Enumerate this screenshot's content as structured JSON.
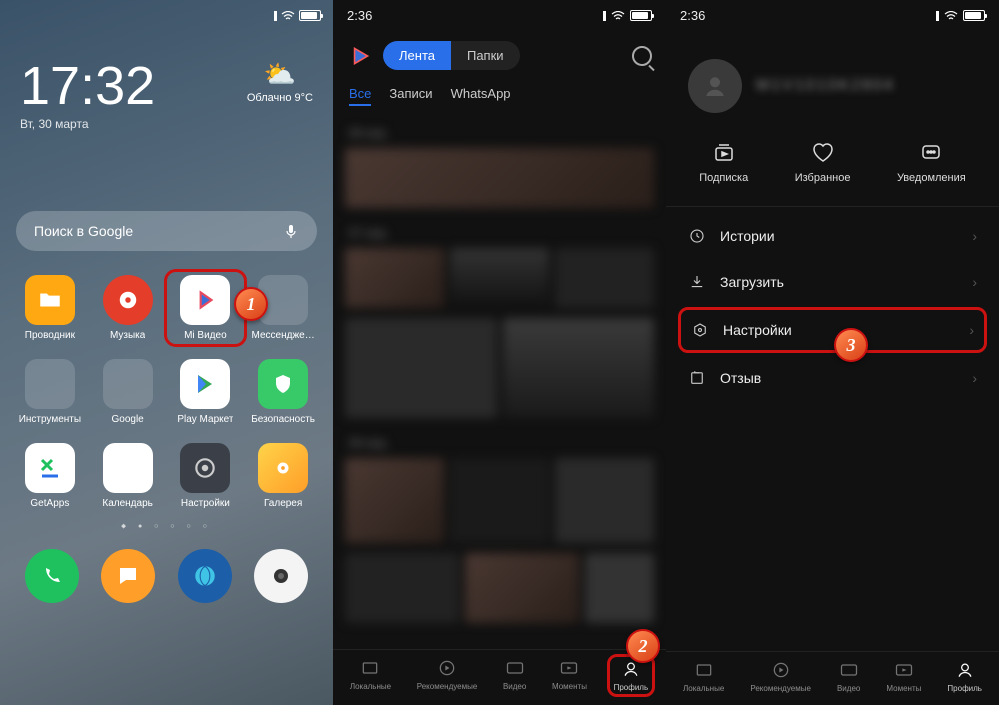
{
  "phone1": {
    "time": "17:32",
    "date": "Вт, 30 марта",
    "weather": {
      "cond": "Облачно",
      "temp": "9°C"
    },
    "search": "Поиск в Google",
    "apps": [
      {
        "label": "Проводник",
        "bg": "#ffa812"
      },
      {
        "label": "Музыка",
        "bg": "#e43d2a"
      },
      {
        "label": "Mi Видео",
        "bg": "#ffffff",
        "hl": true
      },
      {
        "label": "Мессендже…",
        "bg": "#2a2a33",
        "folder": true
      },
      {
        "label": "Инструменты",
        "bg": "#2a2a33",
        "folder": true
      },
      {
        "label": "Google",
        "bg": "#2a2a33",
        "folder": true
      },
      {
        "label": "Play Маркет",
        "bg": "#ffffff"
      },
      {
        "label": "Безопасность",
        "bg": "#38c968"
      },
      {
        "label": "GetApps",
        "bg": "#ffffff"
      },
      {
        "label": "Календарь",
        "bg": "#ffffff"
      },
      {
        "label": "Настройки",
        "bg": "#3a3f48"
      },
      {
        "label": "Галерея",
        "bg": "#ffda44"
      }
    ],
    "dock": [
      {
        "bg": "#1fc15f"
      },
      {
        "bg": "#ff9e28"
      },
      {
        "bg": "#1c5ea8"
      },
      {
        "bg": "#f4f4f4"
      }
    ]
  },
  "phone2": {
    "time": "2:36",
    "tabs": {
      "active": "Лента",
      "other": "Папки"
    },
    "filters": {
      "active": "Все",
      "f2": "Записи",
      "f3": "WhatsApp"
    },
    "dates": [
      "08 апр.",
      "07 апр.",
      "06 апр."
    ],
    "nav": [
      "Локальные",
      "Рекомендуемые",
      "Видео",
      "Моменты",
      "Профиль"
    ]
  },
  "phone3": {
    "time": "2:36",
    "username": "M1V1010K2804",
    "actions": [
      "Подписка",
      "Избранное",
      "Уведомления"
    ],
    "menu": [
      "Истории",
      "Загрузить",
      "Настройки",
      "Отзыв"
    ],
    "nav": [
      "Локальные",
      "Рекомендуемые",
      "Видео",
      "Моменты",
      "Профиль"
    ]
  },
  "markers": {
    "m1": "1",
    "m2": "2",
    "m3": "3"
  }
}
